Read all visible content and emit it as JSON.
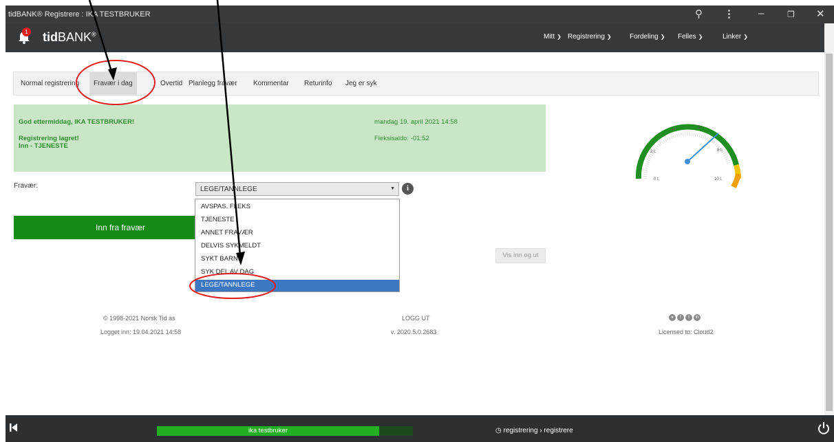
{
  "window": {
    "title": "tidBANK® Registrere : IKA TESTBRUKER"
  },
  "header": {
    "notification_count": "1",
    "logo_bold": "tid",
    "logo_rest": "BANK",
    "logo_reg": "®",
    "nav": [
      "Mitt",
      "Registrering",
      "Fordeling",
      "Felles",
      "Linker"
    ]
  },
  "tabs": [
    "Normal registrering",
    "Fravær i dag",
    "Overtid",
    "Planlegg fravær",
    "Kommentar",
    "Returinfo",
    "Jeg er syk"
  ],
  "active_tab": "Fravær i dag",
  "panel": {
    "greeting": "God ettermiddag, IKA TESTBRUKER!",
    "status": "Registrering lagret!",
    "status_detail": "Inn - TJENESTE",
    "datetime": "mandag 19. april 2021 14:58",
    "flex": "Fleksisaldo: -01:52"
  },
  "gauge": {
    "ticks": [
      "0 t.",
      "2 t.",
      "4 t.",
      "6 t.",
      "8 t.",
      "10 t."
    ]
  },
  "form": {
    "fravaer_label": "Fravær:",
    "selected": "LEGE/TANNLEGE",
    "options": [
      "AVSPAS. FLEKS",
      "TJENESTE",
      "ANNET FRAVÆR",
      "DELVIS SYKMELDT",
      "SYKT BARN",
      "SYK DEL AV DAG",
      "LEGE/TANNLEGE"
    ],
    "inn_button": "Inn fra fravær",
    "vis_button": "Vis inn og ut"
  },
  "footer": {
    "copyright": "© 1998-2021 Norsk Tid as",
    "logged_in": "Logget inn: 19.04.2021 14:58",
    "logout": "LOGG UT",
    "version": "v. 2020.5.0.2683",
    "license": "Licensed to: Cloud2"
  },
  "bottom": {
    "user": "ika testbruker",
    "breadcrumb": "registrering › registrere"
  },
  "colors": {
    "header": "#35393b",
    "accent_green": "#168c16",
    "panel_green": "#c9e7c7",
    "selected_blue": "#3b78c1",
    "annotation_red": "#e02020"
  }
}
